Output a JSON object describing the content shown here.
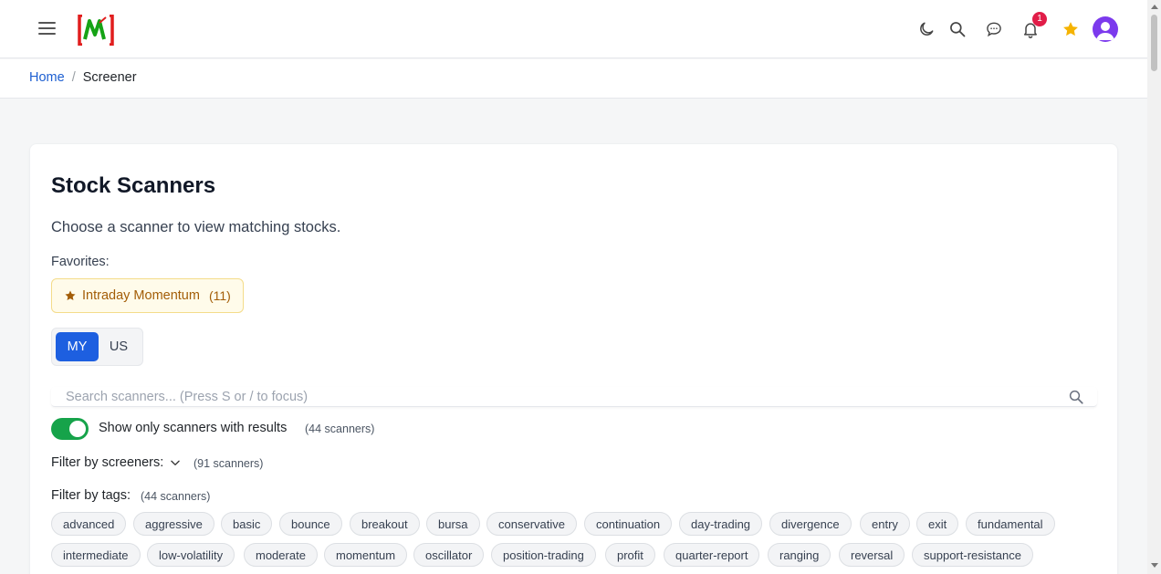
{
  "header": {
    "notification_count": "1",
    "icons": [
      "menu-icon",
      "moon-icon",
      "search-icon",
      "chat-icon",
      "bell-icon",
      "star-icon",
      "avatar"
    ],
    "colors": {
      "badge": "#e11d48",
      "star": "#f5b301",
      "avatar": "#7c3aed"
    }
  },
  "breadcrumb": {
    "home": "Home",
    "separator": "/",
    "current": "Screener"
  },
  "main": {
    "title": "Stock Scanners",
    "subtitle": "Choose a scanner to view matching stocks.",
    "favorites_label": "Favorites:",
    "favorites": [
      {
        "name": "Intraday Momentum",
        "count": "(11)"
      }
    ],
    "markets": {
      "active": "MY",
      "inactive": "US"
    },
    "search": {
      "placeholder": "Search scanners... (Press S or / to focus)",
      "value": ""
    },
    "toggle": {
      "label": "Show only scanners with results",
      "count": "(44 scanners)",
      "on": true
    },
    "filter_screeners": {
      "label": "Filter by screeners:",
      "count": "(91 scanners)"
    },
    "filter_tags": {
      "label": "Filter by tags:",
      "count": "(44 scanners)"
    },
    "tags": [
      "advanced",
      "aggressive",
      "basic",
      "bounce",
      "breakout",
      "bursa",
      "conservative",
      "continuation",
      "day-trading",
      "divergence",
      "entry",
      "exit",
      "fundamental",
      "intermediate",
      "low-volatility",
      "moderate",
      "momentum",
      "oscillator",
      "position-trading",
      "profit",
      "quarter-report",
      "ranging",
      "reversal",
      "support-resistance"
    ],
    "colors": {
      "accent": "#1d5fe0",
      "toggle_on": "#16a34a",
      "favorite_text": "#a35d07"
    }
  }
}
